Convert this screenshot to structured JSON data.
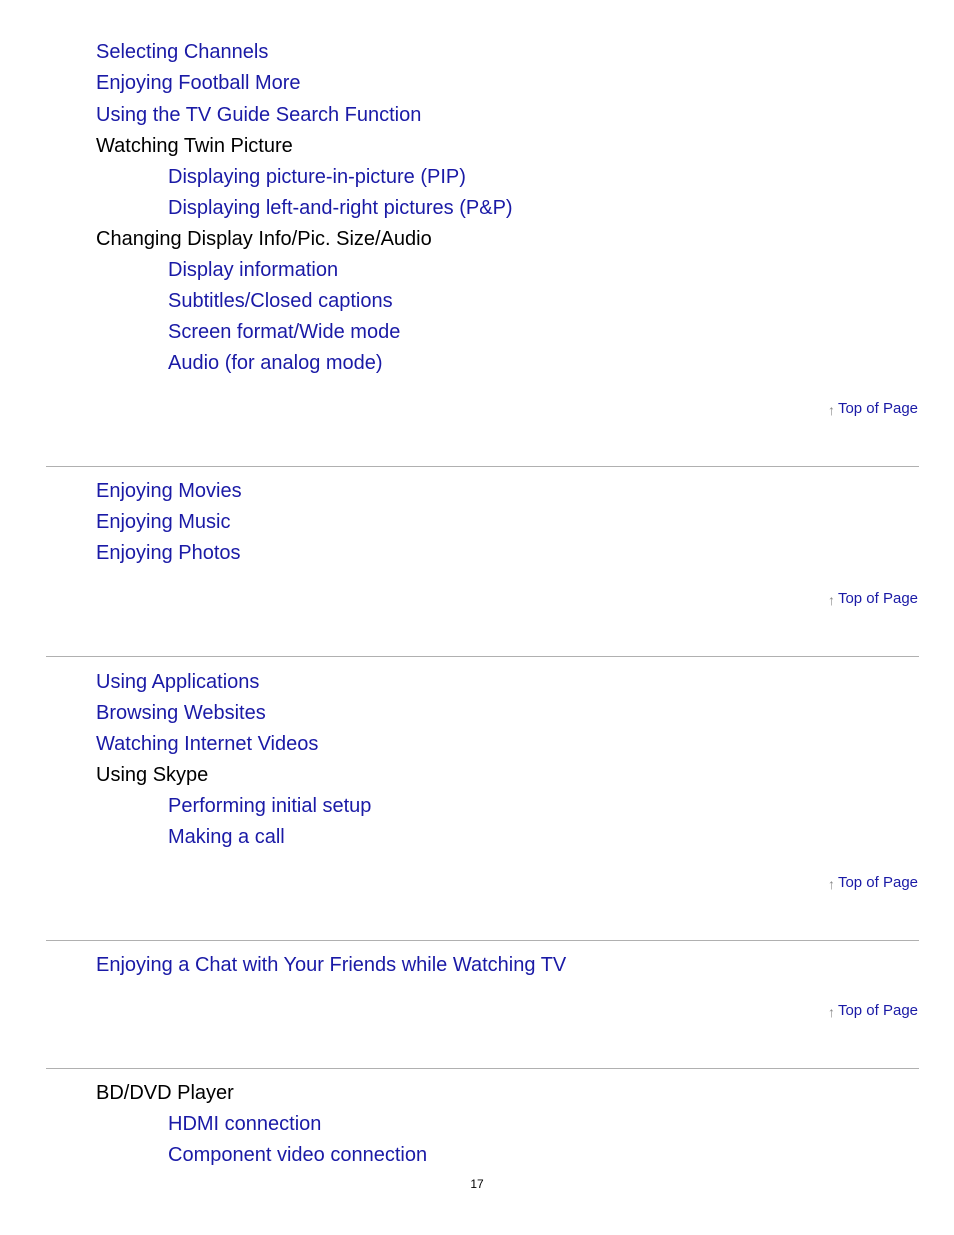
{
  "sections": [
    {
      "items": [
        {
          "label": "Selecting Channels",
          "link": true
        },
        {
          "label": "Enjoying Football More",
          "link": true
        },
        {
          "label": "Using the TV Guide Search Function",
          "link": true
        },
        {
          "label": "Watching Twin Picture",
          "link": false
        },
        {
          "label": "Displaying picture-in-picture (PIP)",
          "link": true
        },
        {
          "label": "Displaying left-and-right pictures (P&P)",
          "link": true
        },
        {
          "label": "Changing Display Info/Pic. Size/Audio",
          "link": false
        },
        {
          "label": "Display information",
          "link": true
        },
        {
          "label": "Subtitles/Closed captions",
          "link": true
        },
        {
          "label": "Screen format/Wide mode",
          "link": true
        },
        {
          "label": "Audio (for analog mode)",
          "link": true
        }
      ]
    },
    {
      "items": [
        {
          "label": "Enjoying Movies",
          "link": true
        },
        {
          "label": "Enjoying Music",
          "link": true
        },
        {
          "label": "Enjoying Photos",
          "link": true
        }
      ]
    },
    {
      "items": [
        {
          "label": "Using Applications",
          "link": true
        },
        {
          "label": "Browsing Websites",
          "link": true
        },
        {
          "label": "Watching Internet Videos",
          "link": true
        },
        {
          "label": "Using Skype",
          "link": false
        },
        {
          "label": "Performing initial setup",
          "link": true
        },
        {
          "label": "Making a call",
          "link": true
        }
      ]
    },
    {
      "items": [
        {
          "label": "Enjoying a Chat with Your Friends while Watching TV",
          "link": true
        }
      ]
    },
    {
      "items": [
        {
          "label": "BD/DVD Player",
          "link": false
        },
        {
          "label": "HDMI connection",
          "link": true
        },
        {
          "label": "Component video connection",
          "link": true
        }
      ]
    }
  ],
  "top_of_page": {
    "label": "Top of Page",
    "icon": "up-arrow-icon",
    "arrow_glyph": "↑"
  },
  "page_number": "17",
  "colors": {
    "link": "#1a1aa6",
    "text": "#000000",
    "rule": "#b0b0b0",
    "arrow": "#888888"
  }
}
